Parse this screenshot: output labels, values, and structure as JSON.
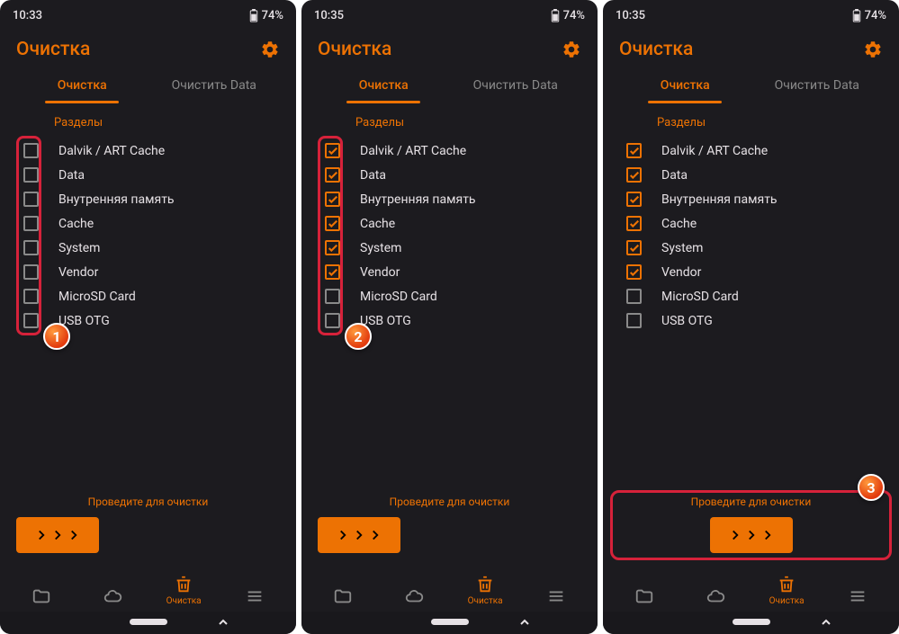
{
  "screens": [
    {
      "time": "10:33",
      "battery": "74%",
      "title": "Очистка",
      "tabs": [
        "Очистка",
        "Очистить Data"
      ],
      "activeTab": 0,
      "sectionLabel": "Разделы",
      "items": [
        {
          "label": "Dalvik / ART Cache",
          "checked": false
        },
        {
          "label": "Data",
          "checked": false
        },
        {
          "label": "Внутренняя память",
          "checked": false
        },
        {
          "label": "Cache",
          "checked": false
        },
        {
          "label": "System",
          "checked": false
        },
        {
          "label": "Vendor",
          "checked": false
        },
        {
          "label": "MicroSD Card",
          "checked": false
        },
        {
          "label": "USB OTG",
          "checked": false
        }
      ],
      "swipeLabel": "Проведите для очистки",
      "swipeCentered": false,
      "navActiveLabel": "Очистка",
      "badge": "1",
      "highlightColumn": true,
      "highlightSwipe": false
    },
    {
      "time": "10:35",
      "battery": "74%",
      "title": "Очистка",
      "tabs": [
        "Очистка",
        "Очистить Data"
      ],
      "activeTab": 0,
      "sectionLabel": "Разделы",
      "items": [
        {
          "label": "Dalvik / ART Cache",
          "checked": true
        },
        {
          "label": "Data",
          "checked": true
        },
        {
          "label": "Внутренняя память",
          "checked": true
        },
        {
          "label": "Cache",
          "checked": true
        },
        {
          "label": "System",
          "checked": true
        },
        {
          "label": "Vendor",
          "checked": true
        },
        {
          "label": "MicroSD Card",
          "checked": false
        },
        {
          "label": "USB OTG",
          "checked": false
        }
      ],
      "swipeLabel": "Проведите для очистки",
      "swipeCentered": false,
      "navActiveLabel": "Очистка",
      "badge": "2",
      "highlightColumn": true,
      "highlightSwipe": false
    },
    {
      "time": "10:35",
      "battery": "74%",
      "title": "Очистка",
      "tabs": [
        "Очистка",
        "Очистить Data"
      ],
      "activeTab": 0,
      "sectionLabel": "Разделы",
      "items": [
        {
          "label": "Dalvik / ART Cache",
          "checked": true
        },
        {
          "label": "Data",
          "checked": true
        },
        {
          "label": "Внутренняя память",
          "checked": true
        },
        {
          "label": "Cache",
          "checked": true
        },
        {
          "label": "System",
          "checked": true
        },
        {
          "label": "Vendor",
          "checked": true
        },
        {
          "label": "MicroSD Card",
          "checked": false
        },
        {
          "label": "USB OTG",
          "checked": false
        }
      ],
      "swipeLabel": "Проведите для очистки",
      "swipeCentered": true,
      "navActiveLabel": "Очистка",
      "badge": "3",
      "highlightColumn": false,
      "highlightSwipe": true
    }
  ],
  "colors": {
    "accent": "#ed7203",
    "bg": "#1c1b1f"
  }
}
